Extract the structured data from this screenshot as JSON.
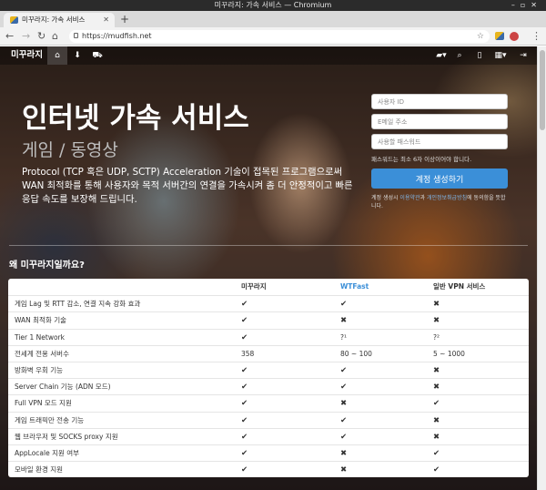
{
  "browser": {
    "window_title": "미꾸라지: 가속 서비스 — Chromium",
    "tab_title": "미꾸라지: 가속 서비스",
    "url": "https://mudfish.net"
  },
  "site": {
    "brand": "미꾸라지",
    "hero_title": "인터넷 가속 서비스",
    "hero_subtitle": "게임 / 동영상",
    "hero_desc": "Protocol (TCP 혹은 UDP, SCTP) Acceleration 기술이 접목된 프로그램으로써 WAN 최적화를 통해 사용자와 목적 서버간의 연결을 가속시켜 좀 더 안정적이고 빠른 응답 속도를 보장해 드립니다.",
    "form": {
      "id_placeholder": "사용자 ID",
      "email_placeholder": "E메일 주소",
      "password_placeholder": "사용할 패스워드",
      "hint": "패스워드는 최소 6자 이상이어야 합니다.",
      "submit": "계정 생성하기",
      "terms_pre": "계정 생성시 ",
      "terms_link1": "이용약관",
      "terms_mid": "과 ",
      "terms_link2": "개인정보취급방침",
      "terms_post": "에 동의함을 뜻합니다."
    },
    "section_title": "왜 미꾸라지일까요?",
    "compare": {
      "headers": [
        "",
        "미꾸라지",
        "WTFast",
        "일반 VPN 서비스"
      ],
      "rows": [
        [
          "게임 Lag 및 RTT 감소, 연결 지속 강화 효과",
          "✔",
          "✔",
          "✖"
        ],
        [
          "WAN 최적화 기술",
          "✔",
          "✖",
          "✖"
        ],
        [
          "Tier 1 Network",
          "✔",
          "?¹",
          "?²"
        ],
        [
          "전세계 전용 서버수",
          "358",
          "80 ~ 100",
          "5 ~ 1000"
        ],
        [
          "방화벽 우회 기능",
          "✔",
          "✔",
          "✖"
        ],
        [
          "Server Chain 기능 (ADN 모드)",
          "✔",
          "✔",
          "✖"
        ],
        [
          "Full VPN 모드 지원",
          "✔",
          "✖",
          "✔"
        ],
        [
          "게임 트래픽만 전송 기능",
          "✔",
          "✔",
          "✖"
        ],
        [
          "웹 브라우저 및 SOCKS proxy 지원",
          "✔",
          "✔",
          "✖"
        ],
        [
          "AppLocale 지원 여부",
          "✔",
          "✖",
          "✔"
        ],
        [
          "모바일 환경 지원",
          "✔",
          "✖",
          "✔"
        ]
      ]
    }
  }
}
